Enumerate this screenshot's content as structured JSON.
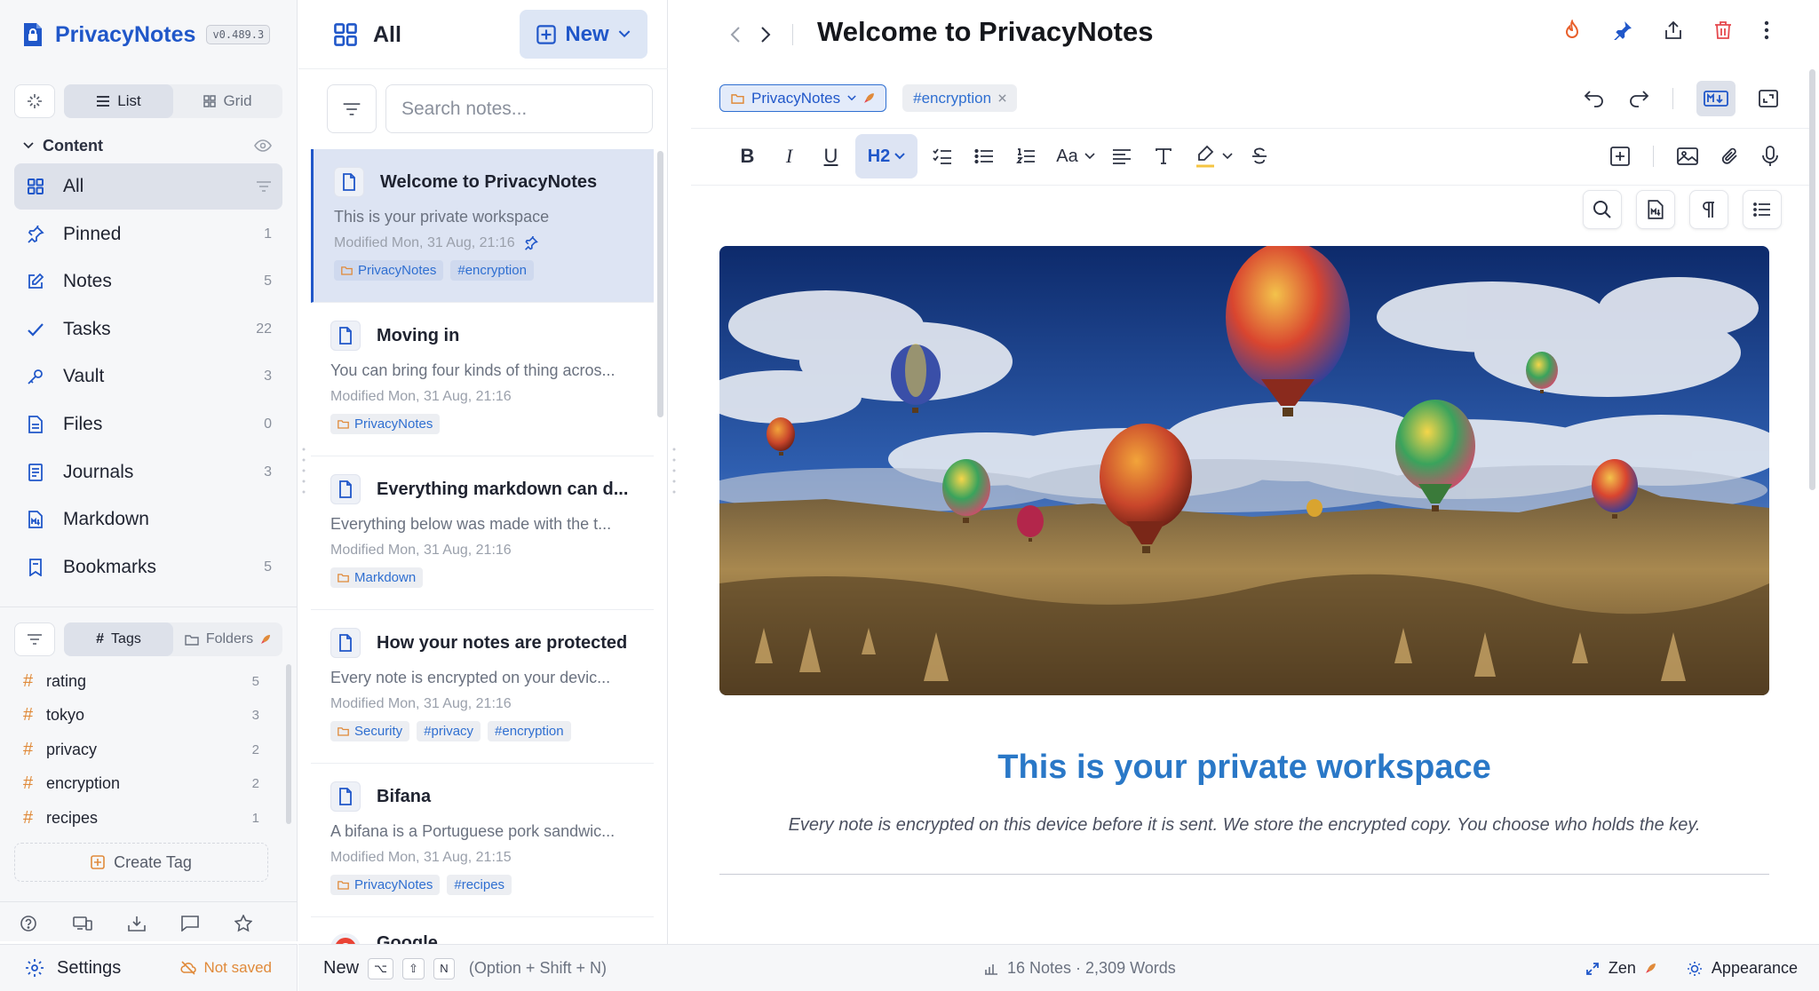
{
  "app": {
    "name": "PrivacyNotes",
    "version": "v0.489.3"
  },
  "view": {
    "list_label": "List",
    "grid_label": "Grid"
  },
  "sidebar": {
    "section_label": "Content",
    "items": [
      {
        "label": "All",
        "count": "",
        "icon": "grid-icon"
      },
      {
        "label": "Pinned",
        "count": "1",
        "icon": "pin-icon"
      },
      {
        "label": "Notes",
        "count": "5",
        "icon": "note-edit-icon"
      },
      {
        "label": "Tasks",
        "count": "22",
        "icon": "check-icon"
      },
      {
        "label": "Vault",
        "count": "3",
        "icon": "key-icon"
      },
      {
        "label": "Files",
        "count": "0",
        "icon": "file-icon"
      },
      {
        "label": "Journals",
        "count": "3",
        "icon": "journal-icon"
      },
      {
        "label": "Markdown",
        "count": "",
        "icon": "markdown-icon"
      },
      {
        "label": "Bookmarks",
        "count": "5",
        "icon": "bookmark-icon"
      }
    ],
    "tag_tabs": {
      "tags_label": "Tags",
      "folders_label": "Folders"
    },
    "tags": [
      {
        "name": "rating",
        "count": "5"
      },
      {
        "name": "tokyo",
        "count": "3"
      },
      {
        "name": "privacy",
        "count": "2"
      },
      {
        "name": "encryption",
        "count": "2"
      },
      {
        "name": "recipes",
        "count": "1"
      }
    ],
    "create_tag_label": "Create Tag",
    "settings_label": "Settings",
    "save_status": "Not saved"
  },
  "notes_list": {
    "heading": "All",
    "new_label": "New",
    "search_placeholder": "Search notes...",
    "notes": [
      {
        "title": "Welcome to PrivacyNotes",
        "excerpt": "This is your private workspace",
        "modified": "Modified Mon, 31 Aug, 21:16",
        "chips": [
          "PrivacyNotes",
          "#encryption"
        ]
      },
      {
        "title": "Moving in",
        "excerpt": "You can bring four kinds of thing acros...",
        "modified": "Modified Mon, 31 Aug, 21:16",
        "chips": [
          "PrivacyNotes"
        ]
      },
      {
        "title": "Everything markdown can d...",
        "excerpt": "Everything below was made with the t...",
        "modified": "Modified Mon, 31 Aug, 21:16",
        "chips": [
          "Markdown"
        ]
      },
      {
        "title": "How your notes are protected",
        "excerpt": "Every note is encrypted on your devic...",
        "modified": "Modified Mon, 31 Aug, 21:16",
        "chips": [
          "Security",
          "#privacy",
          "#encryption"
        ]
      },
      {
        "title": "Bifana",
        "excerpt": "A bifana is a Portuguese pork sandwic...",
        "modified": "Modified Mon, 31 Aug, 21:15",
        "chips": [
          "PrivacyNotes",
          "#recipes"
        ]
      },
      {
        "title": "Google",
        "excerpt": "",
        "modified": "",
        "chips": []
      }
    ]
  },
  "editor": {
    "title": "Welcome to PrivacyNotes",
    "folder": "PrivacyNotes",
    "tag": "#encryption",
    "heading_level": "H2",
    "doc_heading": "This is your private workspace",
    "doc_paragraph": "Every note is encrypted on this device before it is sent. We store the encrypted copy. You choose who holds the key."
  },
  "statusbar": {
    "new_label": "New",
    "keys": [
      "⌥",
      "⇧",
      "N"
    ],
    "shortcut_hint": "(Option + Shift + N)",
    "counts": "16 Notes · 2,309 Words",
    "zen_label": "Zen",
    "appearance_label": "Appearance"
  },
  "colors": {
    "accent": "#2057c9",
    "warning": "#e08a3a",
    "danger": "#e5484d",
    "heading": "#2a78c7"
  }
}
